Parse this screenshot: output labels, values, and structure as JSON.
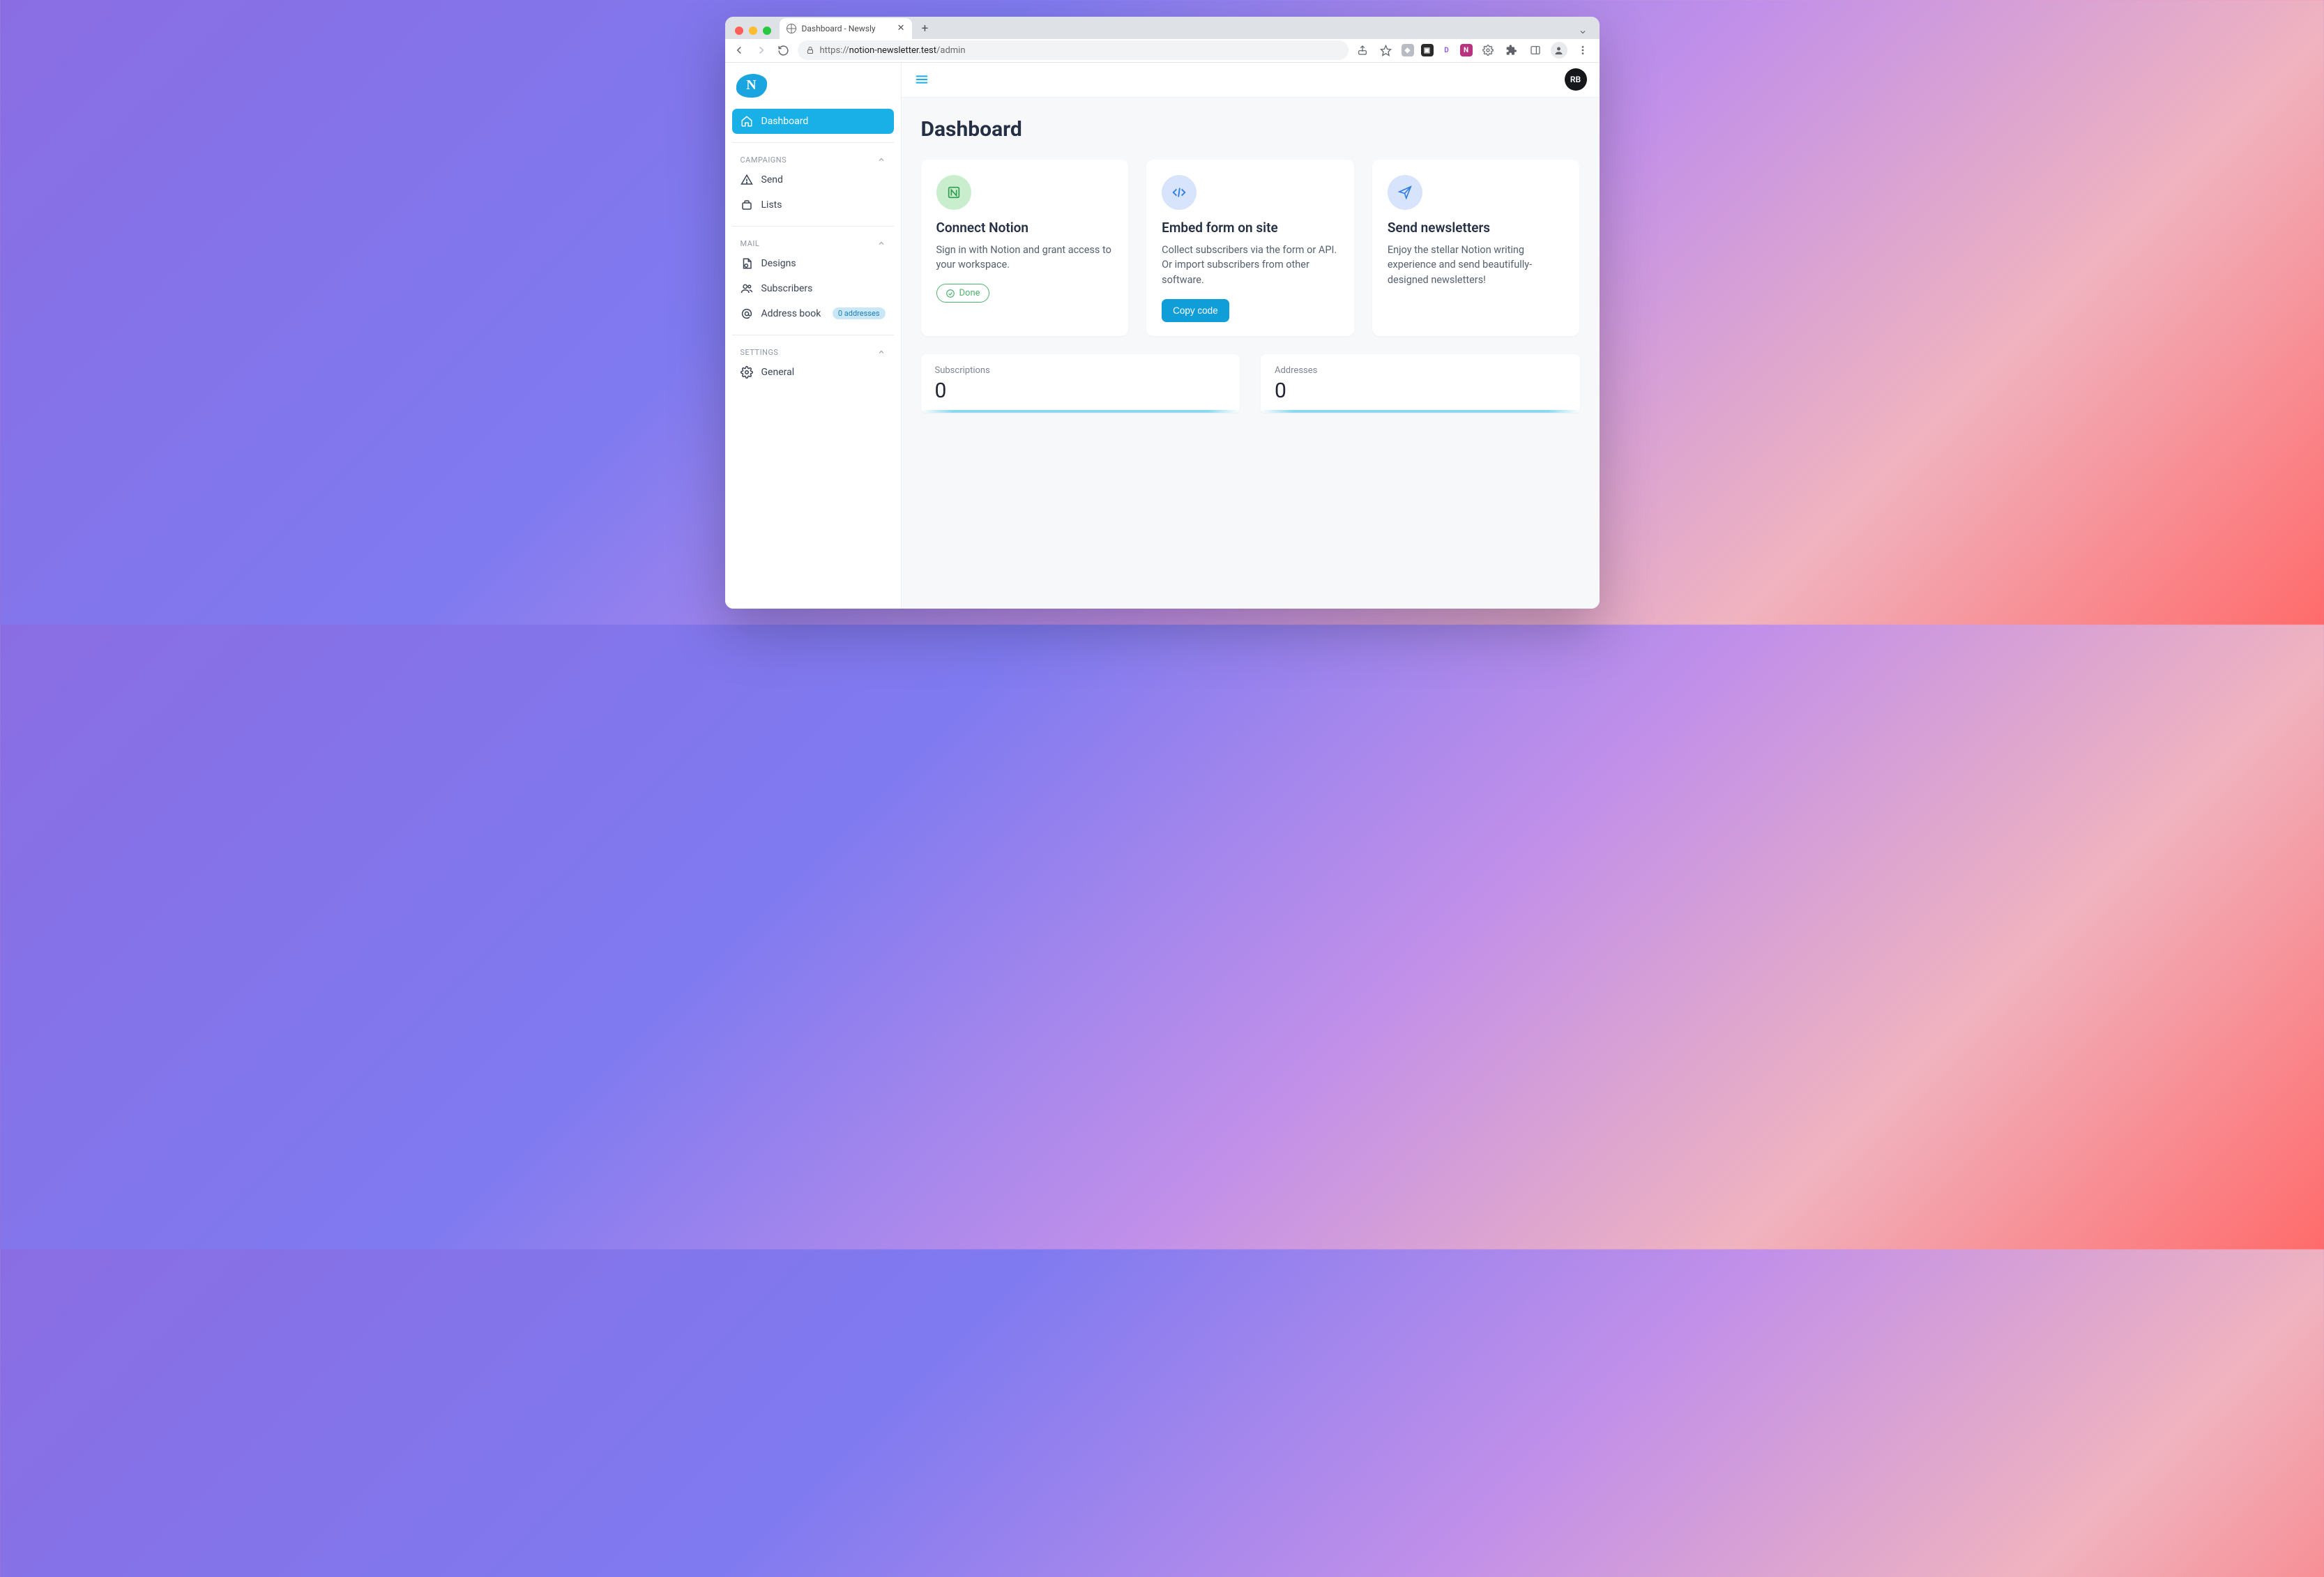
{
  "browser": {
    "tab_title": "Dashboard - Newsly",
    "url_scheme": "https://",
    "url_host": "notion-newsletter.test",
    "url_path": "/admin"
  },
  "sidebar": {
    "logo_letter": "N",
    "primary": {
      "label": "Dashboard"
    },
    "sections": [
      {
        "title": "CAMPAIGNS",
        "items": [
          {
            "label": "Send"
          },
          {
            "label": "Lists"
          }
        ]
      },
      {
        "title": "MAIL",
        "items": [
          {
            "label": "Designs"
          },
          {
            "label": "Subscribers"
          },
          {
            "label": "Address book",
            "badge": "0 addresses"
          }
        ]
      },
      {
        "title": "SETTINGS",
        "items": [
          {
            "label": "General"
          }
        ]
      }
    ]
  },
  "topbar": {
    "avatar": "RB"
  },
  "page": {
    "title": "Dashboard",
    "cards": [
      {
        "title": "Connect Notion",
        "body": "Sign in with Notion and grant access to your workspace.",
        "status_label": "Done"
      },
      {
        "title": "Embed form on site",
        "body": "Collect subscribers via the form or API. Or import subscribers from other software.",
        "button_label": "Copy code"
      },
      {
        "title": "Send newsletters",
        "body": "Enjoy the stellar Notion writing experience and send beautifully-designed newsletters!"
      }
    ],
    "stats": [
      {
        "label": "Subscriptions",
        "value": "0"
      },
      {
        "label": "Addresses",
        "value": "0"
      }
    ]
  }
}
